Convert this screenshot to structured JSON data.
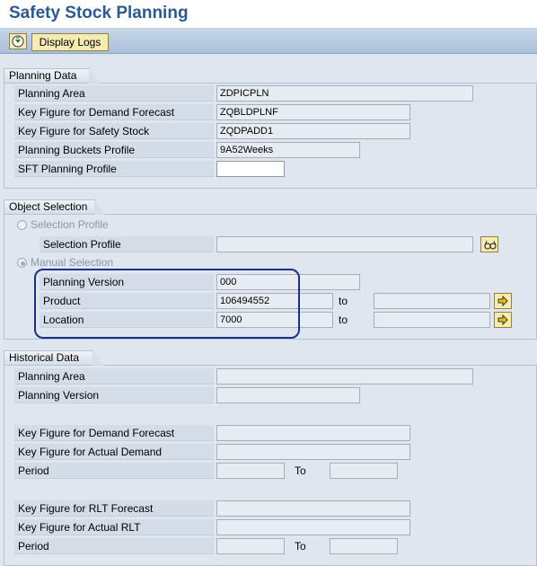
{
  "title": "Safety Stock Planning",
  "toolbar": {
    "display_logs_label": "Display Logs"
  },
  "planning_data": {
    "section_title": "Planning Data",
    "planning_area": {
      "label": "Planning Area",
      "value": "ZDPICPLN"
    },
    "key_figure_demand": {
      "label": "Key Figure for Demand Forecast",
      "value": "ZQBLDPLNF"
    },
    "key_figure_safety": {
      "label": "Key Figure for Safety Stock",
      "value": "ZQDPADD1"
    },
    "buckets_profile": {
      "label": "Planning Buckets Profile",
      "value": "9A52Weeks"
    },
    "sft_profile": {
      "label": "SFT Planning Profile",
      "value": ""
    }
  },
  "object_selection": {
    "section_title": "Object Selection",
    "selection_profile_radio": "Selection Profile",
    "selection_profile_field": {
      "label": "Selection Profile",
      "value": ""
    },
    "manual_selection_radio": "Manual Selection",
    "planning_version": {
      "label": "Planning Version",
      "value": "000"
    },
    "product": {
      "label": "Product",
      "from": "106494552",
      "to_label": "to",
      "to": ""
    },
    "location": {
      "label": "Location",
      "from": "7000",
      "to_label": "to",
      "to": ""
    }
  },
  "historical_data": {
    "section_title": "Historical Data",
    "planning_area": {
      "label": "Planning Area",
      "value": ""
    },
    "planning_version": {
      "label": "Planning Version",
      "value": ""
    },
    "kf_demand_forecast": {
      "label": "Key Figure for Demand Forecast",
      "value": ""
    },
    "kf_actual_demand": {
      "label": "Key Figure for Actual Demand",
      "value": ""
    },
    "period1": {
      "label": "Period",
      "from": "",
      "to_label": "To",
      "to": ""
    },
    "kf_rlt_forecast": {
      "label": "Key Figure for RLT Forecast",
      "value": ""
    },
    "kf_actual_rlt": {
      "label": "Key Figure for Actual RLT",
      "value": ""
    },
    "period2": {
      "label": "Period",
      "from": "",
      "to_label": "To",
      "to": ""
    }
  }
}
